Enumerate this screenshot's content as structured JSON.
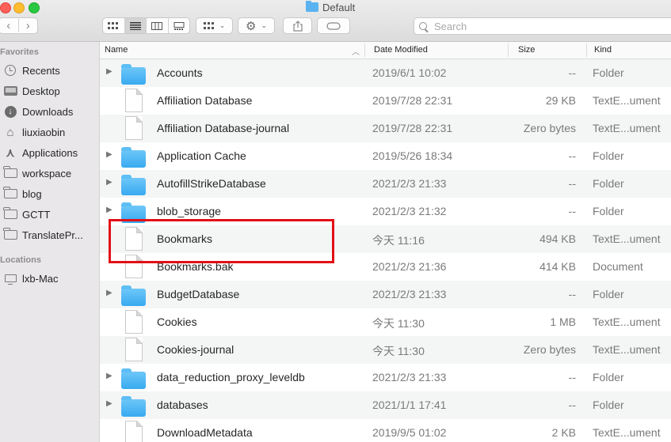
{
  "window": {
    "title": "Default",
    "search_placeholder": "Search"
  },
  "toolbar": {
    "back_label": "‹",
    "forward_label": "›",
    "view_buttons": [
      "icon-view",
      "list-view",
      "column-view",
      "gallery-view"
    ],
    "active_view": "list-view"
  },
  "sidebar": {
    "favorites_heading": "Favorites",
    "locations_heading": "Locations",
    "favorites": [
      {
        "label": "Recents",
        "icon": "clock-icon"
      },
      {
        "label": "Desktop",
        "icon": "desktop-icon"
      },
      {
        "label": "Downloads",
        "icon": "downloads-icon"
      },
      {
        "label": "liuxiaobin",
        "icon": "home-icon"
      },
      {
        "label": "Applications",
        "icon": "applications-icon"
      },
      {
        "label": "workspace",
        "icon": "folder-icon"
      },
      {
        "label": "blog",
        "icon": "folder-icon"
      },
      {
        "label": "GCTT",
        "icon": "folder-icon"
      },
      {
        "label": "TranslatePr...",
        "icon": "folder-icon"
      }
    ],
    "locations": [
      {
        "label": "lxb-Mac",
        "icon": "computer-icon"
      }
    ]
  },
  "columns": {
    "name": "Name",
    "date_modified": "Date Modified",
    "size": "Size",
    "kind": "Kind"
  },
  "files": [
    {
      "name": "Accounts",
      "date": "2019/6/1 10:02",
      "size": "--",
      "kind": "Folder",
      "type": "folder"
    },
    {
      "name": "Affiliation Database",
      "date": "2019/7/28 22:31",
      "size": "29 KB",
      "kind": "TextE...ument",
      "type": "file"
    },
    {
      "name": "Affiliation Database-journal",
      "date": "2019/7/28 22:31",
      "size": "Zero bytes",
      "kind": "TextE...ument",
      "type": "file"
    },
    {
      "name": "Application Cache",
      "date": "2019/5/26 18:34",
      "size": "--",
      "kind": "Folder",
      "type": "folder"
    },
    {
      "name": "AutofillStrikeDatabase",
      "date": "2021/2/3 21:33",
      "size": "--",
      "kind": "Folder",
      "type": "folder"
    },
    {
      "name": "blob_storage",
      "date": "2021/2/3 21:32",
      "size": "--",
      "kind": "Folder",
      "type": "folder"
    },
    {
      "name": "Bookmarks",
      "date": "今天 11:16",
      "size": "494 KB",
      "kind": "TextE...ument",
      "type": "file"
    },
    {
      "name": "Bookmarks.bak",
      "date": "2021/2/3 21:36",
      "size": "414 KB",
      "kind": "Document",
      "type": "file"
    },
    {
      "name": "BudgetDatabase",
      "date": "2021/2/3 21:33",
      "size": "--",
      "kind": "Folder",
      "type": "folder"
    },
    {
      "name": "Cookies",
      "date": "今天 11:30",
      "size": "1 MB",
      "kind": "TextE...ument",
      "type": "file"
    },
    {
      "name": "Cookies-journal",
      "date": "今天 11:30",
      "size": "Zero bytes",
      "kind": "TextE...ument",
      "type": "file"
    },
    {
      "name": "data_reduction_proxy_leveldb",
      "date": "2021/2/3 21:33",
      "size": "--",
      "kind": "Folder",
      "type": "folder"
    },
    {
      "name": "databases",
      "date": "2021/1/1 17:41",
      "size": "--",
      "kind": "Folder",
      "type": "folder"
    },
    {
      "name": "DownloadMetadata",
      "date": "2019/9/5 01:02",
      "size": "2 KB",
      "kind": "TextE...ument",
      "type": "file"
    }
  ],
  "highlighted_file": "Bookmarks",
  "colors": {
    "highlight": "#e30f17",
    "folder": "#45b4f5"
  }
}
